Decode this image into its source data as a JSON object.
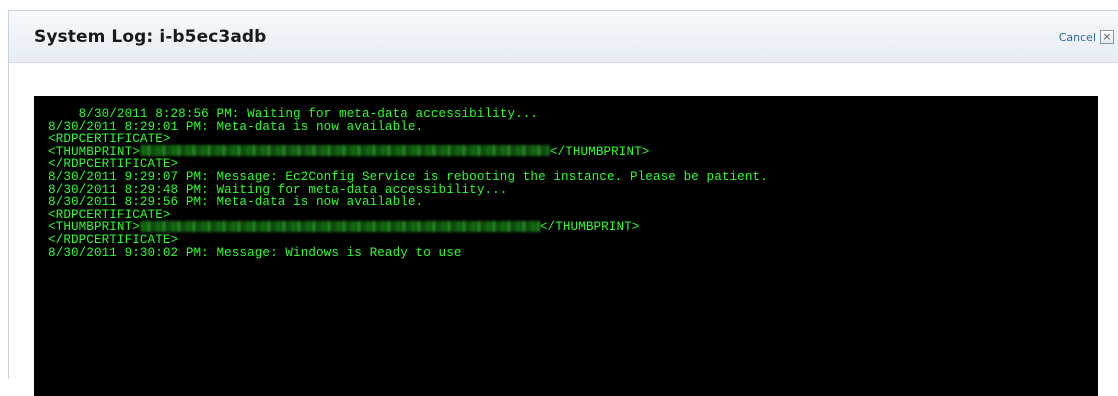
{
  "dialog": {
    "title": "System Log: i-b5ec3adb",
    "cancel_label": "Cancel",
    "close_icon": "×"
  },
  "console": {
    "background": "#000000",
    "text_color": "#2bff2b",
    "lines": [
      {
        "text": "    8/30/2011 8:28:56 PM: Waiting for meta-data accessibility..."
      },
      {
        "text": "8/30/2011 8:29:01 PM: Meta-data is now available."
      },
      {
        "text": "<RDPCERTIFICATE>"
      },
      {
        "prefix": "<THUMBPRINT>",
        "redacted": true,
        "suffix": "</THUMBPRINT>"
      },
      {
        "text": "</RDPCERTIFICATE>"
      },
      {
        "text": "8/30/2011 9:29:07 PM: Message: Ec2Config Service is rebooting the instance. Please be patient."
      },
      {
        "text": "8/30/2011 8:29:48 PM: Waiting for meta-data accessibility..."
      },
      {
        "text": "8/30/2011 8:29:56 PM: Meta-data is now available."
      },
      {
        "text": "<RDPCERTIFICATE>"
      },
      {
        "prefix": "<THUMBPRINT>",
        "redacted": true,
        "suffix": "</THUMBPRINT>"
      },
      {
        "text": "</RDPCERTIFICATE>"
      },
      {
        "text": "8/30/2011 9:30:02 PM: Message: Windows is Ready to use"
      }
    ]
  }
}
